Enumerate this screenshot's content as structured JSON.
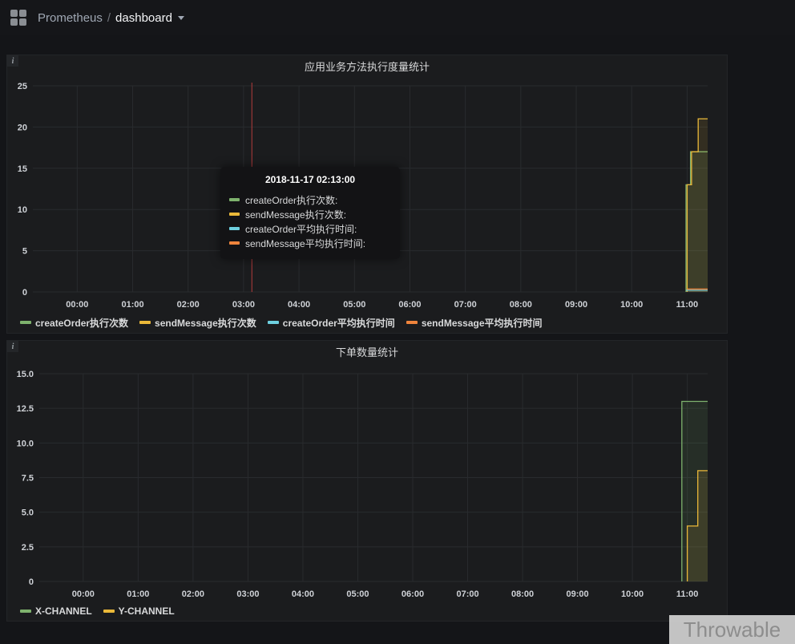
{
  "header": {
    "app": "Prometheus",
    "separator": "/",
    "dashboard": "dashboard"
  },
  "panels": {
    "info_icon": "i"
  },
  "tooltip": {
    "title": "2018-11-17 02:13:00",
    "items": [
      {
        "label": "createOrder执行次数:",
        "color": "#7eb26d"
      },
      {
        "label": "sendMessage执行次数:",
        "color": "#eab839"
      },
      {
        "label": "createOrder平均执行时间:",
        "color": "#6ed0e0"
      },
      {
        "label": "sendMessage平均执行时间:",
        "color": "#ef843c"
      }
    ]
  },
  "watermark": "Throwable",
  "chart_data": [
    {
      "type": "line",
      "title": "应用业务方法执行度量统计",
      "xlabel": "",
      "ylabel": "",
      "grid": true,
      "legend_position": "bottom",
      "xlim": [
        -0.8,
        11.37
      ],
      "ylim": [
        0,
        25
      ],
      "x_ticks": [
        "00:00",
        "01:00",
        "02:00",
        "03:00",
        "04:00",
        "05:00",
        "06:00",
        "07:00",
        "08:00",
        "09:00",
        "10:00",
        "11:00"
      ],
      "y_ticks": [
        {
          "v": 0,
          "label": "0"
        },
        {
          "v": 5,
          "label": "5"
        },
        {
          "v": 10,
          "label": "10"
        },
        {
          "v": 15,
          "label": "15"
        },
        {
          "v": 20,
          "label": "20"
        },
        {
          "v": 25,
          "label": "25"
        }
      ],
      "crosshair": {
        "x": 3.15,
        "color": "#b23a3a"
      },
      "series": [
        {
          "name": "createOrder执行次数",
          "color": "#7eb26d",
          "points": [
            [
              10.98,
              0
            ],
            [
              10.98,
              13
            ],
            [
              11.06,
              13
            ],
            [
              11.06,
              17
            ],
            [
              11.37,
              17
            ]
          ]
        },
        {
          "name": "sendMessage执行次数",
          "color": "#eab839",
          "points": [
            [
              11.0,
              0
            ],
            [
              11.0,
              13
            ],
            [
              11.08,
              13
            ],
            [
              11.08,
              17
            ],
            [
              11.2,
              17
            ],
            [
              11.2,
              21
            ],
            [
              11.37,
              21
            ]
          ]
        },
        {
          "name": "createOrder平均执行时间",
          "color": "#6ed0e0",
          "points": [
            [
              10.98,
              0.2
            ],
            [
              11.37,
              0.2
            ]
          ]
        },
        {
          "name": "sendMessage平均执行时间",
          "color": "#ef843c",
          "points": [
            [
              11.0,
              0.35
            ],
            [
              11.37,
              0.35
            ]
          ]
        }
      ]
    },
    {
      "type": "line",
      "title": "下单数量统计",
      "xlabel": "",
      "ylabel": "",
      "grid": true,
      "legend_position": "bottom",
      "xlim": [
        -0.8,
        11.37
      ],
      "ylim": [
        0,
        15
      ],
      "x_ticks": [
        "00:00",
        "01:00",
        "02:00",
        "03:00",
        "04:00",
        "05:00",
        "06:00",
        "07:00",
        "08:00",
        "09:00",
        "10:00",
        "11:00"
      ],
      "y_ticks": [
        {
          "v": 0,
          "label": "0"
        },
        {
          "v": 2.5,
          "label": "2.5"
        },
        {
          "v": 5,
          "label": "5.0"
        },
        {
          "v": 7.5,
          "label": "7.5"
        },
        {
          "v": 10,
          "label": "10.0"
        },
        {
          "v": 12.5,
          "label": "12.5"
        },
        {
          "v": 15,
          "label": "15.0"
        }
      ],
      "series": [
        {
          "name": "X-CHANNEL",
          "color": "#7eb26d",
          "points": [
            [
              10.9,
              0
            ],
            [
              10.9,
              13
            ],
            [
              11.37,
              13
            ]
          ]
        },
        {
          "name": "Y-CHANNEL",
          "color": "#eab839",
          "points": [
            [
              11.0,
              0
            ],
            [
              11.0,
              4
            ],
            [
              11.19,
              4
            ],
            [
              11.19,
              8
            ],
            [
              11.37,
              8
            ]
          ]
        }
      ]
    }
  ]
}
